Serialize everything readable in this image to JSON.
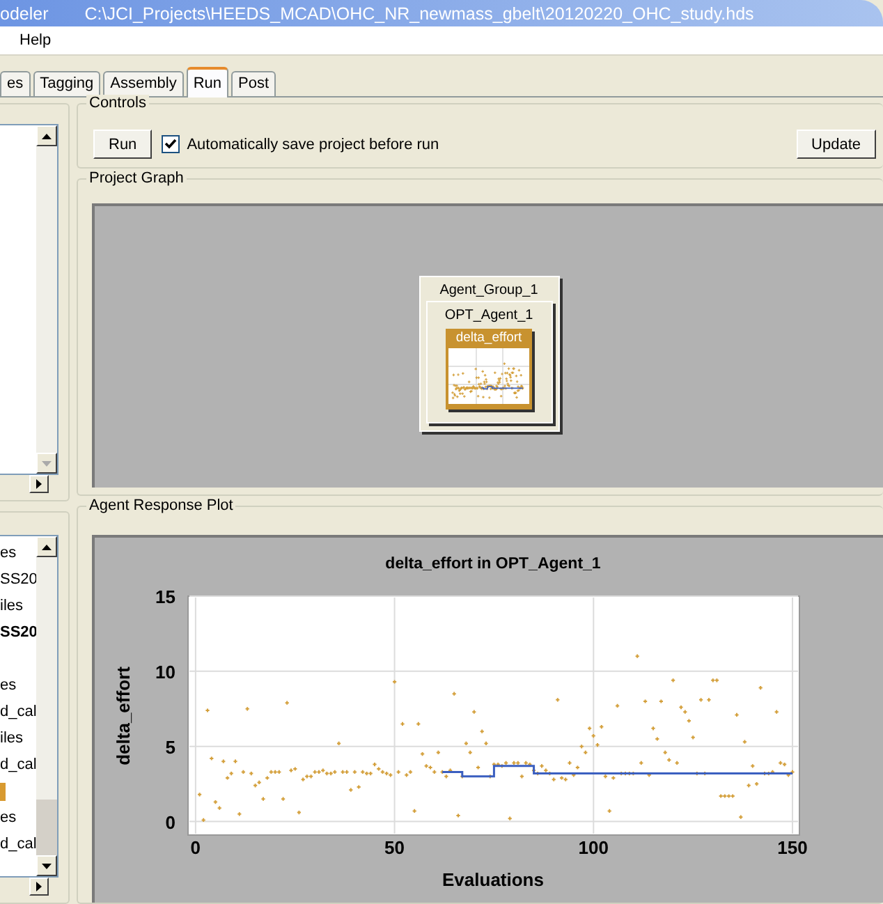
{
  "window": {
    "app_name": "odeler",
    "file_path": "C:\\JCI_Projects\\HEEDS_MCAD\\OHC_NR_newmass_gbelt\\20120220_OHC_study.hds"
  },
  "menu": [
    "Help"
  ],
  "tabs": [
    {
      "label": "es",
      "selected": false
    },
    {
      "label": "Tagging",
      "selected": false
    },
    {
      "label": "Assembly",
      "selected": false
    },
    {
      "label": "Run",
      "selected": true
    },
    {
      "label": "Post",
      "selected": false
    }
  ],
  "left_list": [
    {
      "kind": "text",
      "text": "es",
      "bold": false
    },
    {
      "kind": "text",
      "text": "SS20",
      "bold": false
    },
    {
      "kind": "text",
      "text": "iles",
      "bold": false
    },
    {
      "kind": "text",
      "text": "SS20",
      "bold": true
    },
    {
      "kind": "gap"
    },
    {
      "kind": "text",
      "text": "es",
      "bold": false
    },
    {
      "kind": "text",
      "text": "d_cal",
      "bold": false
    },
    {
      "kind": "text",
      "text": "iles",
      "bold": false
    },
    {
      "kind": "text",
      "text": "d_cal",
      "bold": false
    },
    {
      "kind": "marker"
    },
    {
      "kind": "text",
      "text": "es",
      "bold": false
    },
    {
      "kind": "text",
      "text": "d_cal",
      "bold": false
    }
  ],
  "controls": {
    "title": "Controls",
    "run_button": "Run",
    "autosave": {
      "label": "Automatically save project before run",
      "checked": true
    },
    "update_button": "Update"
  },
  "project_graph": {
    "title": "Project Graph",
    "group": "Agent_Group_1",
    "agent": "OPT_Agent_1",
    "response": "delta_effort"
  },
  "response_plot": {
    "title": "Agent Response Plot",
    "chart_data": {
      "type": "scatter",
      "title": "delta_effort in OPT_Agent_1",
      "xlabel": "Evaluations",
      "ylabel": "delta_effort",
      "x": [
        1,
        2,
        3,
        4,
        5,
        6,
        7,
        8,
        9,
        10,
        11,
        12,
        13,
        14,
        15,
        16,
        17,
        18,
        19,
        20,
        21,
        22,
        23,
        24,
        25,
        26,
        27,
        28,
        29,
        30,
        31,
        32,
        33,
        34,
        35,
        36,
        37,
        38,
        39,
        40,
        41,
        42,
        43,
        44,
        45,
        46,
        47,
        48,
        49,
        50,
        51,
        52,
        53,
        54,
        55,
        56,
        57,
        58,
        59,
        60,
        61,
        62,
        63,
        64,
        65,
        66,
        67,
        68,
        69,
        70,
        71,
        72,
        73,
        74,
        75,
        76,
        77,
        78,
        79,
        80,
        81,
        82,
        83,
        84,
        85,
        86,
        87,
        88,
        89,
        90,
        91,
        92,
        93,
        94,
        95,
        96,
        97,
        98,
        99,
        100,
        101,
        102,
        103,
        104,
        105,
        106,
        107,
        108,
        109,
        110,
        111,
        112,
        113,
        114,
        115,
        116,
        117,
        118,
        119,
        120,
        121,
        122,
        123,
        124,
        125,
        126,
        127,
        128,
        129,
        130,
        131,
        132,
        133,
        134,
        135,
        136,
        137,
        138,
        139,
        140,
        141,
        142,
        143,
        144,
        145,
        146,
        147,
        148,
        149,
        150
      ],
      "series": [
        {
          "type": "scatter",
          "color": "#d4a03c",
          "values": [
            1.8,
            0.1,
            7.4,
            4.2,
            1.3,
            0.9,
            4.0,
            2.9,
            3.2,
            4.0,
            0.5,
            3.3,
            7.5,
            3.2,
            2.4,
            2.6,
            1.5,
            2.9,
            3.3,
            3.3,
            3.3,
            1.5,
            7.9,
            3.4,
            3.5,
            0.6,
            2.8,
            3.0,
            3.0,
            3.3,
            3.3,
            3.4,
            3.2,
            3.2,
            3.3,
            5.2,
            3.3,
            3.3,
            2.1,
            3.3,
            2.3,
            3.3,
            3.2,
            3.2,
            3.8,
            3.5,
            3.3,
            3.2,
            3.1,
            9.3,
            3.3,
            6.5,
            3.1,
            3.3,
            0.7,
            6.5,
            4.5,
            3.7,
            3.6,
            3.3,
            4.6,
            3.3,
            3.0,
            3.4,
            8.5,
            0.4,
            3.0,
            5.2,
            4.6,
            7.3,
            3.6,
            6.0,
            5.2,
            3.0,
            3.8,
            3.8,
            3.7,
            3.9,
            0.2,
            3.9,
            3.9,
            3.0,
            3.9,
            3.8,
            3.4,
            3.2,
            3.7,
            3.4,
            3.2,
            2.8,
            8.1,
            2.9,
            2.8,
            3.9,
            3.1,
            3.6,
            5.0,
            4.6,
            6.2,
            5.7,
            5.1,
            6.3,
            3.0,
            0.7,
            2.9,
            7.7,
            3.2,
            3.2,
            3.2,
            3.2,
            11.0,
            3.9,
            8.0,
            3.1,
            6.2,
            5.5,
            8.0,
            4.6,
            4.1,
            9.4,
            3.9,
            7.6,
            7.3,
            6.7,
            5.6,
            3.2,
            8.1,
            3.2,
            8.1,
            9.4,
            9.4,
            1.7,
            1.7,
            1.7,
            1.7,
            7.1,
            0.3,
            5.3,
            2.4,
            3.7,
            2.5,
            8.9,
            3.2,
            3.2,
            3.3,
            7.3,
            3.9,
            3.8,
            3.1,
            3.3
          ]
        },
        {
          "type": "line",
          "color": "#3b5fc0",
          "values": [
            null,
            null,
            null,
            null,
            null,
            null,
            null,
            null,
            null,
            null,
            null,
            null,
            null,
            null,
            null,
            null,
            null,
            null,
            null,
            null,
            null,
            null,
            null,
            null,
            null,
            null,
            null,
            null,
            null,
            null,
            null,
            null,
            null,
            null,
            null,
            null,
            null,
            null,
            null,
            null,
            null,
            null,
            null,
            null,
            null,
            null,
            null,
            null,
            null,
            null,
            null,
            null,
            null,
            null,
            null,
            null,
            null,
            null,
            null,
            null,
            null,
            3.3,
            3.3,
            3.3,
            3.3,
            3.3,
            3.0,
            3.0,
            3.0,
            3.0,
            3.0,
            3.0,
            3.0,
            3.0,
            3.7,
            3.7,
            3.7,
            3.7,
            3.7,
            3.7,
            3.7,
            3.7,
            3.7,
            3.7,
            3.2,
            3.2,
            3.2,
            3.2,
            3.2,
            3.2,
            3.2,
            3.2,
            3.2,
            3.2,
            3.2,
            3.2,
            3.2,
            3.2,
            3.2,
            3.2,
            3.2,
            3.2,
            3.2,
            3.2,
            3.2,
            3.2,
            3.2,
            3.2,
            3.2,
            3.2,
            3.2,
            3.2,
            3.2,
            3.2,
            3.2,
            3.2,
            3.2,
            3.2,
            3.2,
            3.2,
            3.2,
            3.2,
            3.2,
            3.2,
            3.2,
            3.2,
            3.2,
            3.2,
            3.2,
            3.2,
            3.2,
            3.2,
            3.2,
            3.2,
            3.2,
            3.2,
            3.2,
            3.2,
            3.2,
            3.2,
            3.2,
            3.2,
            3.2,
            3.2,
            3.2,
            3.2,
            3.2,
            3.2,
            3.2,
            3.2
          ]
        }
      ],
      "xlim": [
        -1.9,
        151.75
      ],
      "ylim": [
        -0.9,
        15
      ],
      "xticks": [
        0,
        50,
        100,
        150
      ],
      "yticks": [
        0,
        5,
        10,
        15
      ],
      "grid": true
    }
  }
}
